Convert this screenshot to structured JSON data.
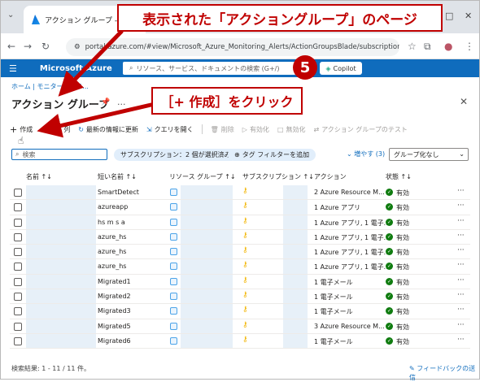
{
  "browser": {
    "tab_title": "アクション グループ - Microsoft Az",
    "url": "portal.azure.com/#view/Microsoft_Azure_Monitoring_Alerts/ActionGroupsBlade/subscriptions~/",
    "controls": {
      "minimize": "—",
      "maximize": "□",
      "close": "✕"
    }
  },
  "azure": {
    "brand": "Microsoft Azure",
    "search_placeholder": "リソース、サービス、ドキュメントの検索 (G+/)",
    "copilot": "Copilot"
  },
  "page": {
    "breadcrumb": "ホーム | モニター | アラ...",
    "title": "アクション グループ",
    "more": "..."
  },
  "toolbar": {
    "create": "作成",
    "columns": "列",
    "refresh": "最新の情報に更新",
    "open_query": "クエリを開く",
    "delete": "削除",
    "enable": "有効化",
    "disable": "無効化",
    "test": "アクション グループのテスト"
  },
  "filters": {
    "search_placeholder": "検索",
    "subscription_pill": "サブスクリプション：2 個が選択済み",
    "tag_filter": "タグ フィルターを追加",
    "more": "増やす (3)",
    "grouping": "グループ化なし"
  },
  "table": {
    "headers": [
      "名前 ↑↓",
      "短い名前 ↑↓",
      "リソース グループ ↑↓",
      "サブスクリプション ↑↓",
      "アクション",
      "状態 ↑↓"
    ],
    "rows": [
      {
        "short_name": "SmartDetect",
        "action": "2 Azure Resource M...",
        "status": "有効"
      },
      {
        "short_name": "azureapp",
        "action": "1 Azure アプリ",
        "status": "有効"
      },
      {
        "short_name": "hs m s a",
        "action": "1 Azure アプリ, 1 電子...",
        "status": "有効"
      },
      {
        "short_name": "azure_hs",
        "action": "1 Azure アプリ, 1 電子...",
        "status": "有効"
      },
      {
        "short_name": "azure_hs",
        "action": "1 Azure アプリ, 1 電子...",
        "status": "有効"
      },
      {
        "short_name": "azure_hs",
        "action": "1 Azure アプリ, 1 電子...",
        "status": "有効"
      },
      {
        "short_name": "Migrated1",
        "action": "1 電子メール",
        "status": "有効"
      },
      {
        "short_name": "Migrated2",
        "action": "1 電子メール",
        "status": "有効"
      },
      {
        "short_name": "Migrated3",
        "action": "1 電子メール",
        "status": "有効"
      },
      {
        "short_name": "Migrated5",
        "action": "3 Azure Resource M...",
        "status": "有効"
      },
      {
        "short_name": "Migrated6",
        "action": "1 電子メール",
        "status": "有効"
      }
    ]
  },
  "footer": {
    "results": "検索結果: 1 - 11 / 11 件。",
    "feedback": "フィードバックの送信"
  },
  "annotations": {
    "callout_top": "表示された「アクショングループ」のページ",
    "step_number": "5",
    "callout_create": "［+ 作成］をクリック"
  }
}
